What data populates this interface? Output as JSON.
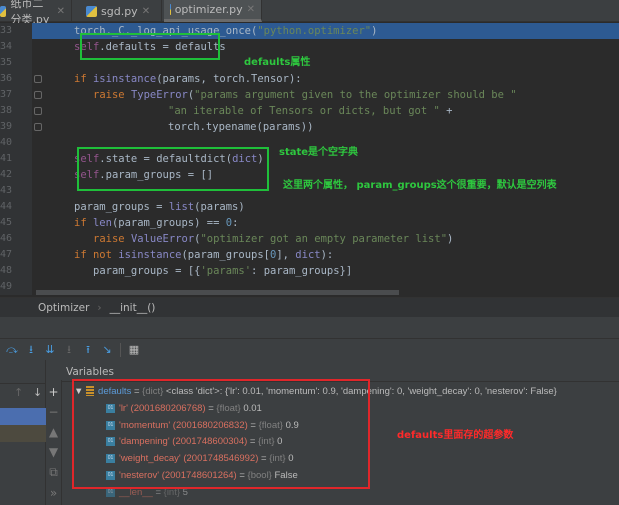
{
  "tabs": [
    {
      "label": "纸币二分类.py"
    },
    {
      "label": "sgd.py"
    },
    {
      "label": "optimizer.py",
      "active": true
    }
  ],
  "line_numbers": [
    "33",
    "34",
    "35",
    "36",
    "37",
    "38",
    "39",
    "40",
    "41",
    "42",
    "43",
    "44",
    "45",
    "46",
    "47",
    "48",
    "49"
  ],
  "code": {
    "l33a": "torch._C._log_api_usage_once(",
    "l33b": "\"python.optimizer\"",
    "l33c": ")",
    "l34a": "self",
    "l34b": ".defaults = defaults",
    "l36a": "if ",
    "l36b": "isinstance",
    "l36c": "(params, torch.Tensor):",
    "l37a": "raise ",
    "l37b": "TypeError",
    "l37c": "(",
    "l37d": "\"params argument given to the optimizer should be \"",
    "l38a": "\"an iterable of Tensors or dicts, but got \"",
    "l38b": " +",
    "l39": "torch.typename(params))",
    "l41a": "self",
    "l41b": ".state = defaultdict(",
    "l41c": "dict",
    "l41d": ")",
    "l42a": "self",
    "l42b": ".param_groups = []",
    "l44a": "param_groups = ",
    "l44b": "list",
    "l44c": "(params)",
    "l45a": "if ",
    "l45b": "len",
    "l45c": "(param_groups) == ",
    "l45d": "0",
    "l45e": ":",
    "l46a": "raise ",
    "l46b": "ValueError",
    "l46c": "(",
    "l46d": "\"optimizer got an empty parameter list\"",
    "l46e": ")",
    "l47a": "if not ",
    "l47b": "isinstance",
    "l47c": "(param_groups[",
    "l47d": "0",
    "l47e": "], ",
    "l47f": "dict",
    "l47g": "):",
    "l48a": "param_groups = [{",
    "l48b": "'params'",
    "l48c": ": param_groups}]"
  },
  "annotations": {
    "defaults": "defaults属性",
    "state": "state是个空字典",
    "param_groups": "这里两个属性， param_groups这个很重要，默认是空列表",
    "hyperparams": "defaults里面存的超参数"
  },
  "breadcrumb": {
    "class": "Optimizer",
    "method": "__init__()"
  },
  "variables": {
    "header": "Variables",
    "defaults": {
      "name": "defaults",
      "eq": " = ",
      "type": "{dict}",
      "value": " <class 'dict'>: {'lr': 0.01, 'momentum': 0.9, 'dampening': 0, 'weight_decay': 0, 'nesterov': False}"
    },
    "items": [
      {
        "name": "'lr' (2001680206768)",
        "type": "{float}",
        "value": "0.01"
      },
      {
        "name": "'momentum' (2001680206832)",
        "type": "{float}",
        "value": "0.9"
      },
      {
        "name": "'dampening' (2001748600304)",
        "type": "{int}",
        "value": "0"
      },
      {
        "name": "'weight_decay' (2001748546992)",
        "type": "{int}",
        "value": "0"
      },
      {
        "name": "'nesterov' (2001748601264)",
        "type": "{bool}",
        "value": "False"
      },
      {
        "name": "__len__",
        "type": "{int}",
        "value": "5"
      }
    ]
  }
}
